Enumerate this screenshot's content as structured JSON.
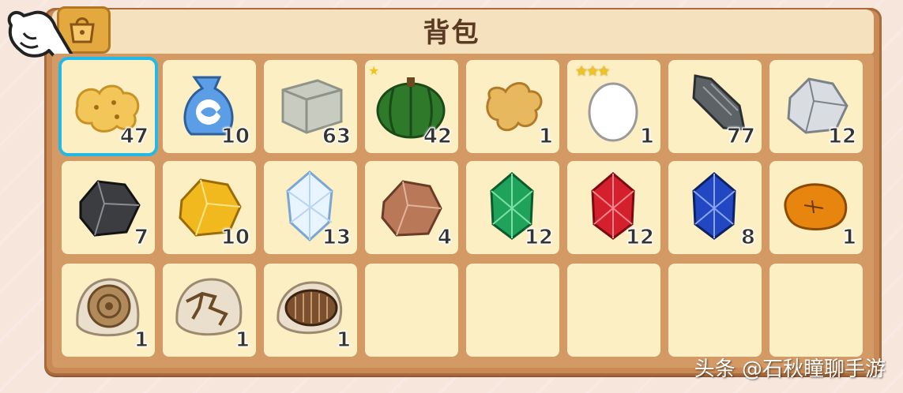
{
  "title": "背包",
  "watermark": "头条 @石秋瞳聊手游",
  "selected_slot": 0,
  "items": [
    {
      "name": "cookie",
      "count": "47"
    },
    {
      "name": "fish-feed-bag",
      "count": "10"
    },
    {
      "name": "stone-block",
      "count": "63"
    },
    {
      "name": "pumpkin",
      "count": "42",
      "stars": "★"
    },
    {
      "name": "ginger",
      "count": "1"
    },
    {
      "name": "egg",
      "count": "1",
      "stars": "★★★"
    },
    {
      "name": "dark-ore-chunk",
      "count": "77"
    },
    {
      "name": "silver-ore",
      "count": "12"
    },
    {
      "name": "black-ore",
      "count": "7"
    },
    {
      "name": "gold-ore",
      "count": "10"
    },
    {
      "name": "diamond",
      "count": "13"
    },
    {
      "name": "copper-ore",
      "count": "4"
    },
    {
      "name": "emerald",
      "count": "12"
    },
    {
      "name": "ruby",
      "count": "12"
    },
    {
      "name": "sapphire",
      "count": "8"
    },
    {
      "name": "amber",
      "count": "1"
    },
    {
      "name": "ammonite-fossil",
      "count": "1"
    },
    {
      "name": "dinosaur-fossil",
      "count": "1"
    },
    {
      "name": "trilobite-fossil",
      "count": "1"
    },
    {
      "name": "empty",
      "count": ""
    },
    {
      "name": "empty",
      "count": ""
    },
    {
      "name": "empty",
      "count": ""
    },
    {
      "name": "empty",
      "count": ""
    },
    {
      "name": "empty",
      "count": ""
    }
  ]
}
